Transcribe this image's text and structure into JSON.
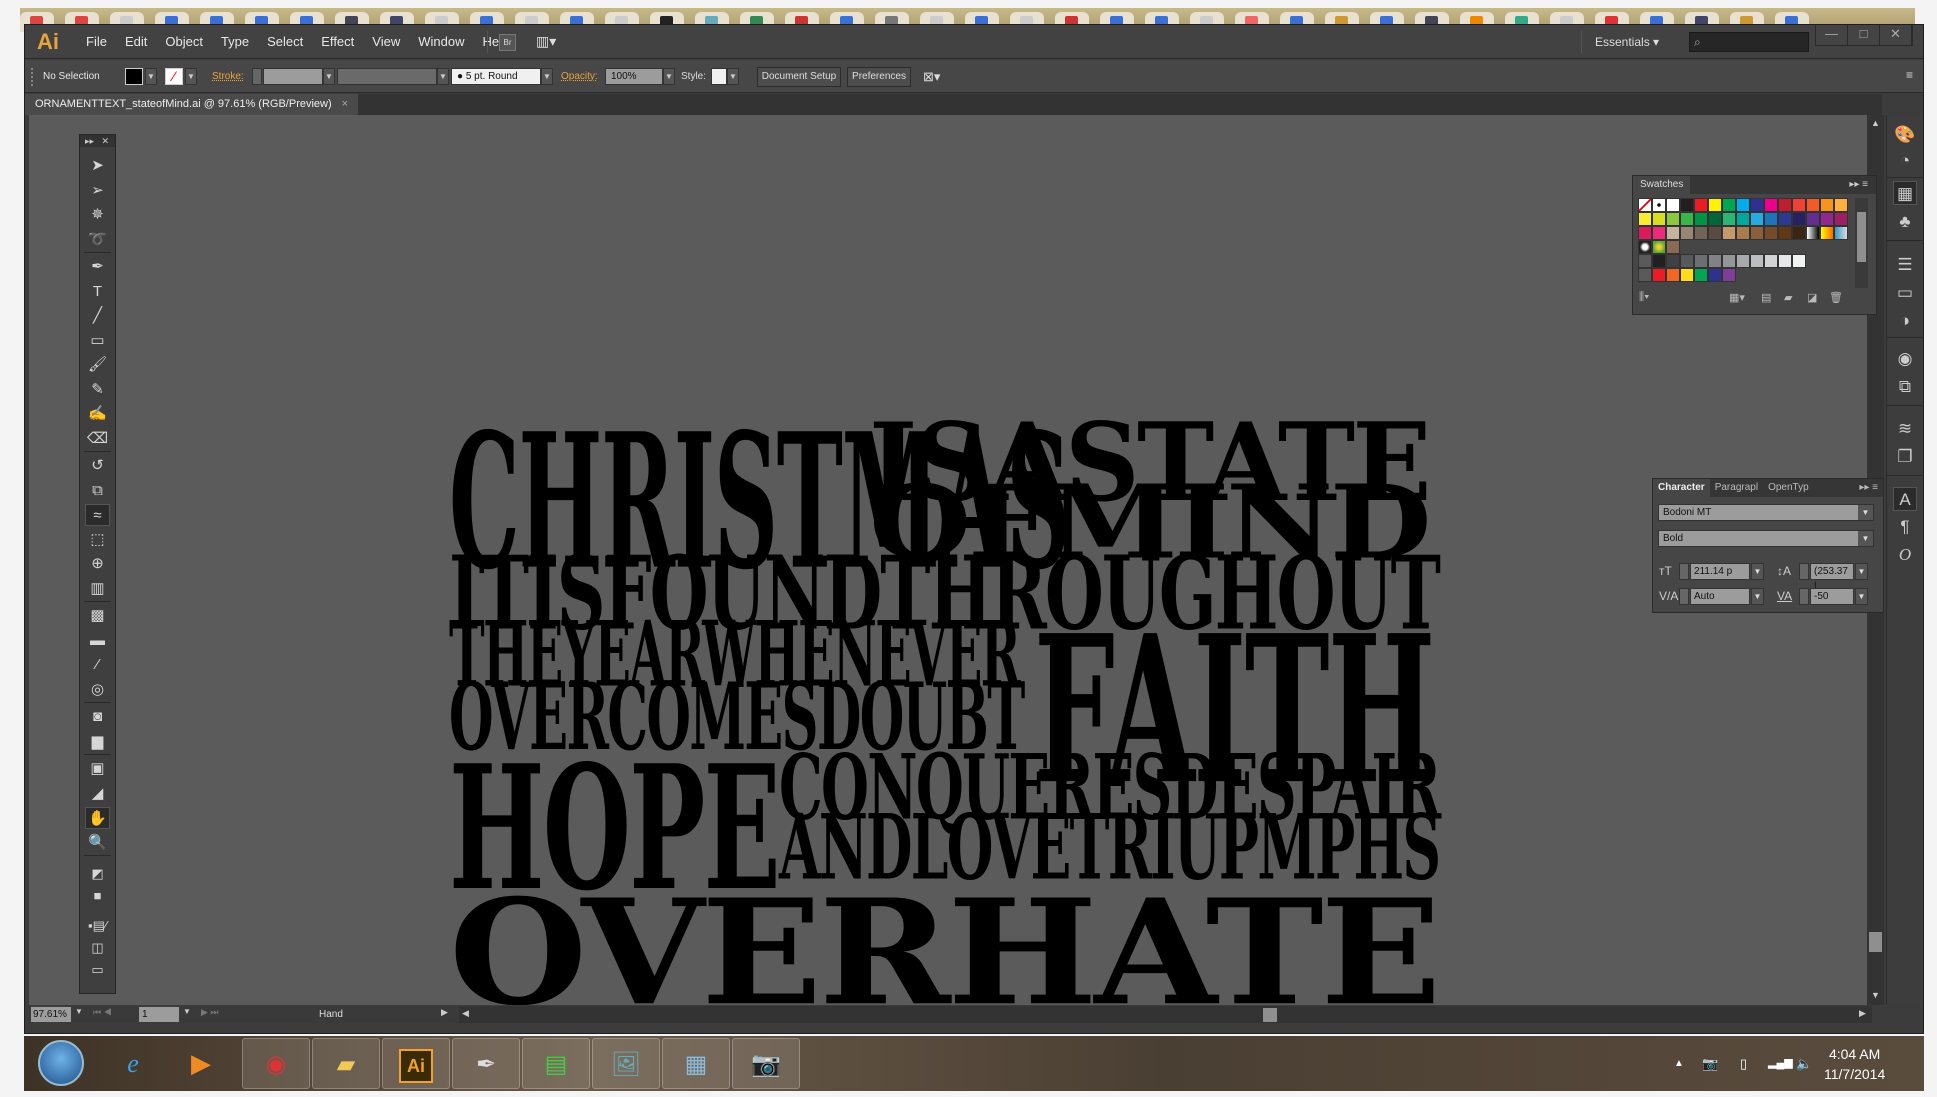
{
  "browser_tabs_count": 40,
  "app": {
    "logo": "Ai",
    "menu": [
      "File",
      "Edit",
      "Object",
      "Type",
      "Select",
      "Effect",
      "View",
      "Window",
      "Help"
    ],
    "bridge_label": "Br",
    "workspace": "Essentials",
    "search_placeholder": "",
    "window_controls": [
      "—",
      "□",
      "✕"
    ]
  },
  "control_bar": {
    "selection": "No Selection",
    "fill_color": "#000000",
    "stroke_label": "Stroke:",
    "stroke_value": "",
    "brush": "5 pt. Round",
    "opacity_label": "Opacity:",
    "opacity_value": "100%",
    "style_label": "Style:",
    "document_setup": "Document Setup",
    "preferences": "Preferences"
  },
  "document": {
    "tab_title": "ORNAMENTTEXT_stateofMind.ai @ 97.61% (RGB/Preview)",
    "close": "×"
  },
  "artwork": {
    "lines": [
      {
        "text": "CHRISTMAS",
        "id": "christmas"
      },
      {
        "text": "ISASTATE",
        "id": "is-a-state"
      },
      {
        "text": "OFMIND",
        "id": "of-mind"
      },
      {
        "text": "ITISFOUNDTHROUGHOUT",
        "id": "it-is-found-throughout"
      },
      {
        "text": "THEYEARWHENEVER",
        "id": "the-year-whenever"
      },
      {
        "text": "FAITH",
        "id": "faith"
      },
      {
        "text": "OVERCOMESDOUBT",
        "id": "overcomes-doubt"
      },
      {
        "text": "HOPE",
        "id": "hope"
      },
      {
        "text": "CONQUERESDESPAIR",
        "id": "conqueres-despair"
      },
      {
        "text": "ANDLOVETRIUPMPHS",
        "id": "and-love-triupmphs"
      },
      {
        "text": "OVERHATE",
        "id": "over-hate"
      }
    ]
  },
  "status": {
    "zoom": "97.61%",
    "page": "1",
    "tool": "Hand"
  },
  "tools": [
    "selection",
    "direct-selection",
    "magic-wand",
    "lasso",
    "pen",
    "type",
    "line-segment",
    "rectangle",
    "paintbrush",
    "pencil",
    "blob-brush",
    "eraser",
    "rotate",
    "scale",
    "width",
    "free-transform",
    "shape-builder",
    "perspective-grid",
    "mesh",
    "gradient",
    "eyedropper",
    "blend",
    "symbol-sprayer",
    "column-graph",
    "artboard",
    "slice",
    "hand",
    "zoom"
  ],
  "swatches": {
    "title": "Swatches",
    "rows": [
      [
        "none",
        "registration",
        "#ffffff",
        "#231f20",
        "#ed1c24",
        "#fff200",
        "#00a651",
        "#00aeef",
        "#2e3192",
        "#ec008c",
        "#be1e2d",
        "#ef4136",
        "#f15a29",
        "#f7941d",
        "#fbb040"
      ],
      [
        "#f9ed32",
        "#d7df23",
        "#8dc63f",
        "#39b54a",
        "#009444",
        "#006838",
        "#2bb673",
        "#00a79d",
        "#27aae1",
        "#1c75bc",
        "#2b3990",
        "#262262",
        "#662d91",
        "#92278f",
        "#9e1f63"
      ],
      [
        "#da1c5c",
        "#ee2a7b",
        "#c2b59b",
        "#998675",
        "#736357",
        "#594a42",
        "#c49a6c",
        "#a97c50",
        "#8b5e3c",
        "#754c29",
        "#603913",
        "#3c2415",
        "gradient-bw",
        "gradient-orange",
        "pattern-blue"
      ],
      [
        "pattern-1",
        "pattern-2",
        "pattern-3"
      ],
      [
        "folder",
        "#231f20",
        "#414042",
        "#58595b",
        "#6d6e71",
        "#808285",
        "#939598",
        "#a7a9ac",
        "#bcbec0",
        "#d1d3d4",
        "#e6e7e8",
        "#f1f2f2"
      ],
      [
        "folder",
        "#ed1c24",
        "#f26522",
        "#ffde17",
        "#00a651",
        "#2e3192",
        "#7f3f98"
      ]
    ]
  },
  "character": {
    "tabs": [
      "Character",
      "Paragrapl",
      "OpenTyp"
    ],
    "font_family": "Bodoni MT",
    "font_style": "Bold",
    "font_size": "211.14 p",
    "leading": "(253.37 |",
    "kerning": "Auto",
    "tracking": "-50"
  },
  "taskbar": {
    "apps": [
      "internet-explorer",
      "windows-media-player",
      "chrome",
      "file-explorer",
      "illustrator",
      "inkscape",
      "resource-monitor",
      "photo-viewer",
      "calculator",
      "camera"
    ],
    "ai_label": "Ai",
    "time": "4:04 AM",
    "date": "11/7/2014"
  }
}
